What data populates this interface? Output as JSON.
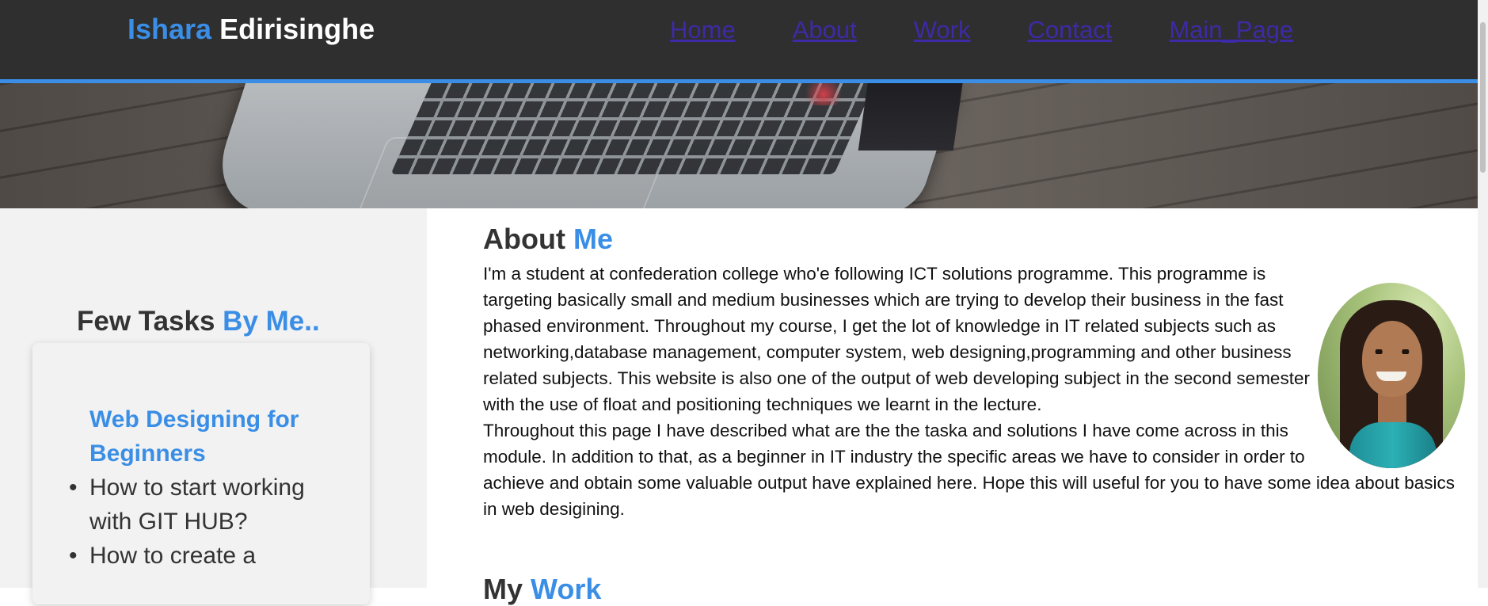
{
  "header": {
    "brand_first": "Ishara",
    "brand_last": "Edirisinghe",
    "nav": [
      "Home",
      "About",
      "Work",
      "Contact",
      "Main_Page"
    ]
  },
  "sidebar": {
    "title_part1": "Few Tasks",
    "title_part2": "By Me..",
    "card_title": "Web Designing for Beginners",
    "tasks": [
      "How to start working with GIT HUB?",
      "How to create a"
    ]
  },
  "main": {
    "about_title_part1": "About",
    "about_title_part2": "Me",
    "paragraph1": "I'm a student at confederation college who'e following ICT solutions programme. This programme is targeting basically small and medium businesses which are trying to develop their business in the fast phased environment. Throughout my course, I get the lot of knowledge in IT related subjects such as networking,database management, computer system, web designing,programming and other business related subjects. This website is also one of the output of web developing subject in the second semester with the use of float and positioning techniques we learnt in the lecture.",
    "paragraph2": "Throughout this page I have described what are the the taska and solutions I have come across in this module. In addition to that, as a beginner in IT industry the specific areas we have to consider in order to achieve and obtain some valuable output have explained here. Hope this will useful for you to have some idea about basics in web desigining.",
    "work_title_part1": "My",
    "work_title_part2": "Work"
  },
  "colors": {
    "accent": "#3a8ee6",
    "header_bg": "#2f2f2f",
    "nav_link": "#3d2aa6",
    "sidebar_bg": "#f2f2f2"
  },
  "icons": [
    "profile-photo",
    "hero-laptop-image"
  ]
}
